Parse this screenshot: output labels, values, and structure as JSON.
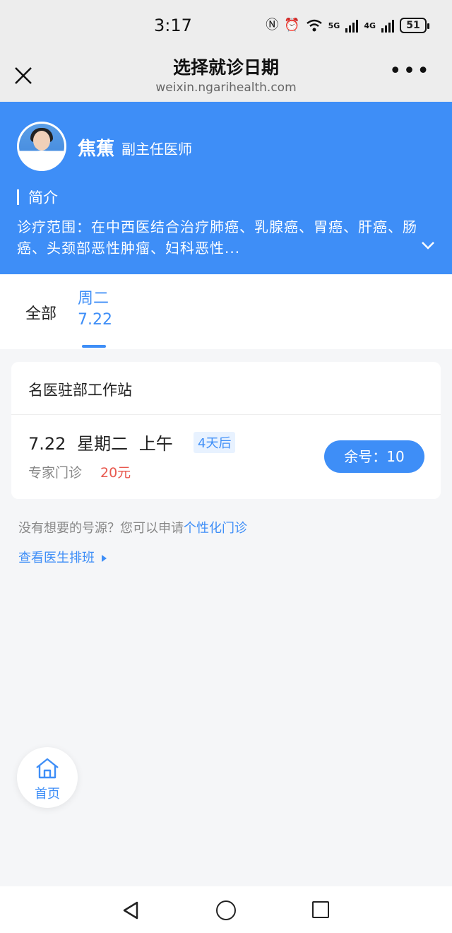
{
  "status_bar": {
    "time": "3:17",
    "net1": "5G",
    "net2": "4G",
    "battery": "51"
  },
  "nav": {
    "title": "选择就诊日期",
    "subtitle": "weixin.ngarihealth.com",
    "more": "•••"
  },
  "doctor": {
    "name": "焦蕉",
    "title": "副主任医师",
    "intro_label": "简介",
    "intro_text": "诊疗范围：在中西医结合治疗肺癌、乳腺癌、胃癌、肝癌、肠癌、头颈部恶性肿瘤、妇科恶性..."
  },
  "tabs": {
    "all": "全部",
    "day_week": "周二",
    "day_date": "7.22"
  },
  "slot": {
    "station": "名医驻部工作站",
    "date_line": "7.22  星期二  上午",
    "badge": "4天后",
    "type": "专家门诊",
    "price": "20元",
    "remain": "余号：10"
  },
  "hint": {
    "text": "没有想要的号源？您可以申请",
    "link": "个性化门诊"
  },
  "schedule_link": "查看医生排班",
  "home": {
    "label": "首页"
  },
  "colors": {
    "primary": "#3e8ef7",
    "price": "#e8594f"
  }
}
